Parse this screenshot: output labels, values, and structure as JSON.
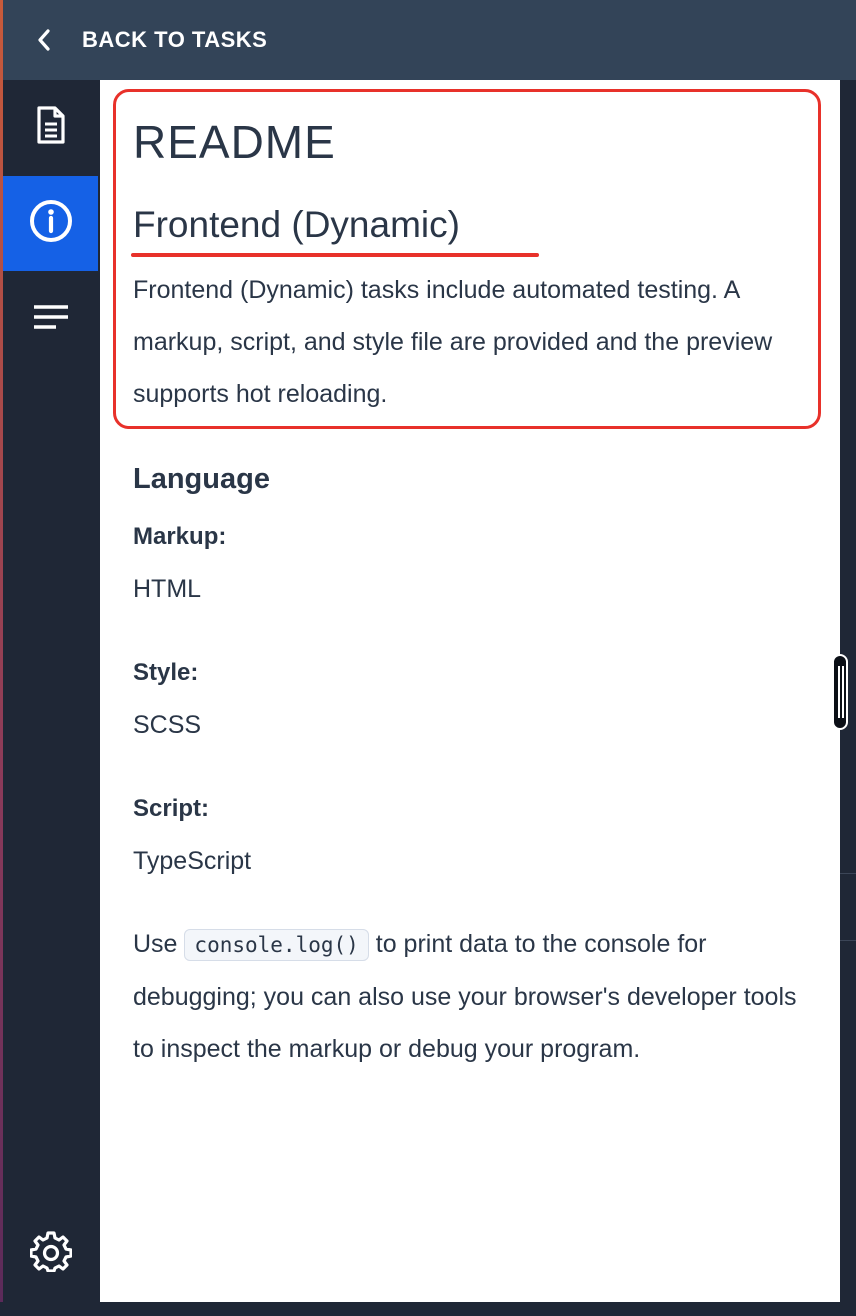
{
  "topbar": {
    "back_label": "BACK TO TASKS",
    "back_icon": "chevron-left-icon"
  },
  "rail": {
    "items": [
      {
        "icon": "document-icon",
        "active": false
      },
      {
        "icon": "info-circle-icon",
        "active": true
      },
      {
        "icon": "lines-menu-icon",
        "active": false
      }
    ],
    "settings_icon": "gear-icon",
    "active_color": "#1561e6"
  },
  "readme": {
    "title": "README",
    "subtitle": "Frontend (Dynamic)",
    "intro": "Frontend (Dynamic) tasks include automated testing. A markup, script, and style file are provided and the preview supports hot reloading."
  },
  "language": {
    "heading": "Language",
    "fields": [
      {
        "label": "Markup:",
        "value": "HTML"
      },
      {
        "label": "Style:",
        "value": "SCSS"
      },
      {
        "label": "Script:",
        "value": "TypeScript"
      }
    ]
  },
  "debug": {
    "prefix": "Use",
    "code": "console.log()",
    "suffix": "to print data to the console for debugging; you can also use your browser's developer tools to inspect the markup or debug your program."
  },
  "colors": {
    "highlight": "#e8312a",
    "topbar": "#334458",
    "rail": "#1f2736",
    "text": "#2a3647"
  }
}
